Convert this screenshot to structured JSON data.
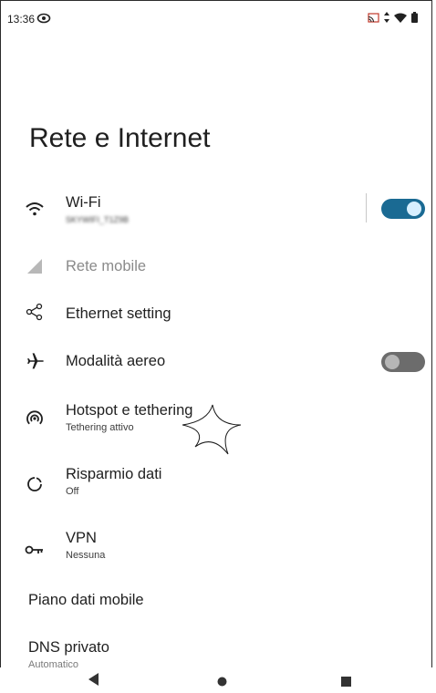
{
  "status_bar": {
    "time": "13:36",
    "icons": [
      "eye-icon",
      "cast-icon",
      "data-arrows-icon",
      "wifi-signal-icon",
      "battery-icon"
    ]
  },
  "page": {
    "title": "Rete e Internet"
  },
  "items": [
    {
      "title": "Wi-Fi",
      "subtitle": "SKYWIFI_T1Z9B",
      "icon": "wifi-icon",
      "toggle": true
    },
    {
      "title": "Rete mobile",
      "icon": "cell-signal-icon",
      "disabled": true
    },
    {
      "title": "Ethernet setting",
      "icon": "ethernet-share-icon"
    },
    {
      "title": "Modalità aereo",
      "icon": "airplane-icon",
      "toggle": false
    },
    {
      "title": "Hotspot e tethering",
      "subtitle": "Tethering attivo",
      "icon": "hotspot-icon"
    },
    {
      "title": "Risparmio dati",
      "subtitle": "Off",
      "icon": "data-saver-icon"
    },
    {
      "title": "VPN",
      "subtitle": "Nessuna",
      "icon": "vpn-key-icon"
    },
    {
      "title": "Piano dati mobile"
    },
    {
      "title": "DNS privato",
      "subtitle": "Automatico"
    }
  ],
  "nav_bar": {
    "icons": [
      "back-icon",
      "home-icon",
      "recents-icon"
    ]
  },
  "colors": {
    "accent": "#1a6a93",
    "toggle_off": "#6c6c6c"
  }
}
